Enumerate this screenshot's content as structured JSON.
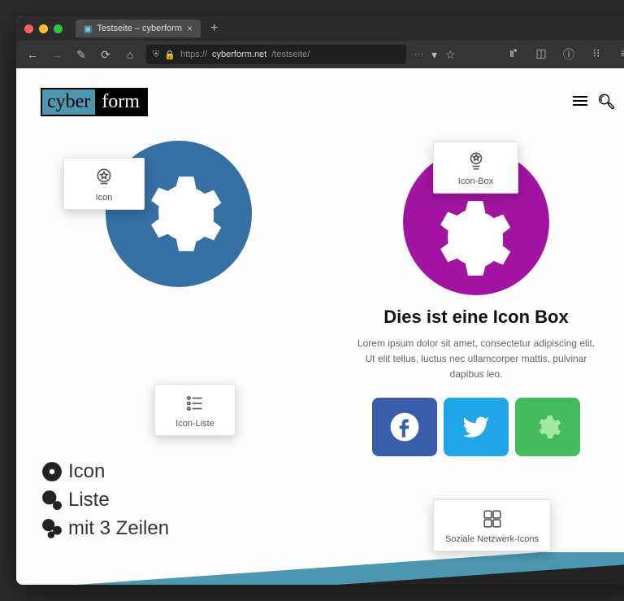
{
  "browser": {
    "tab_title": "Testseite – cyberform",
    "url_prefix": "https://",
    "url_host": "cyberform.net",
    "url_path": "/testseite/"
  },
  "header": {
    "logo_left": "cyber",
    "logo_right": "form"
  },
  "cards": {
    "icon": "Icon",
    "iconlist": "Icon-Liste",
    "iconbox": "Icon-Box",
    "social": "Soziale Netzwerk-Icons"
  },
  "iconbox": {
    "title": "Dies ist eine Icon Box",
    "text": "Lorem ipsum dolor sit amet, consectetur adipiscing elit. Ut elit tellus, luctus nec ullamcorper mattis, pulvinar dapibus leo."
  },
  "iconlist": {
    "lines": [
      "Icon",
      "Liste",
      "mit 3 Zeilen"
    ]
  }
}
